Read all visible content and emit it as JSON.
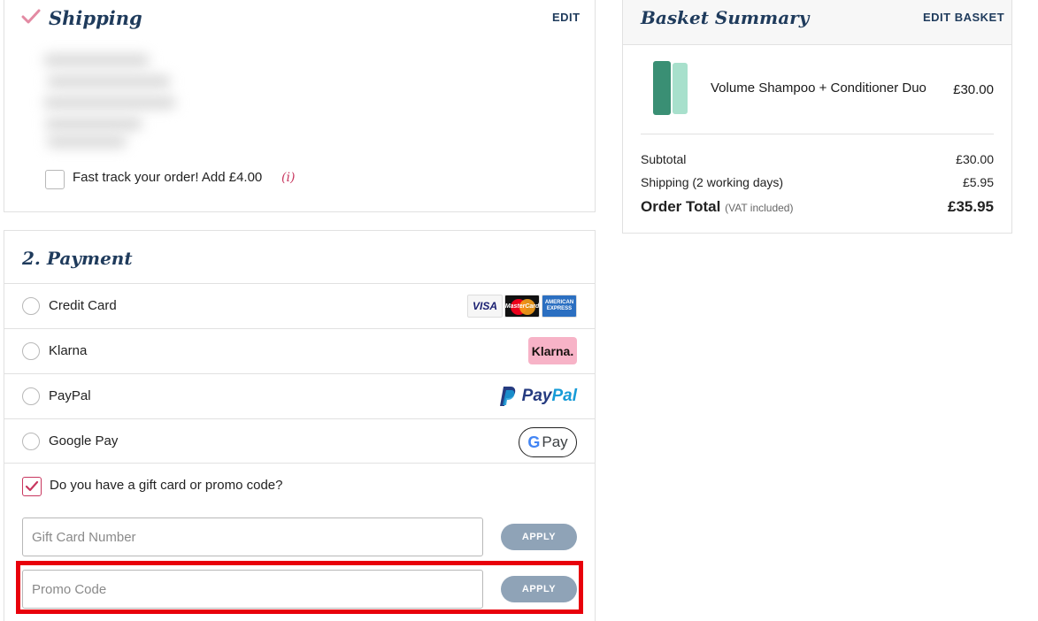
{
  "shipping": {
    "title": "Shipping",
    "edit_label": "EDIT",
    "fast_track_label": "Fast track your order! Add £4.00",
    "info_glyph": "(i)"
  },
  "payment": {
    "title": "2. Payment",
    "methods": [
      {
        "label": "Credit Card",
        "logo": "visa-mastercard-amex-logos"
      },
      {
        "label": "Klarna",
        "logo_text": "Klarna."
      },
      {
        "label": "PayPal",
        "logo_text_1": "Pay",
        "logo_text_2": "Pal"
      },
      {
        "label": "Google Pay",
        "logo_text_g": "G",
        "logo_text_pay": "Pay"
      }
    ],
    "card_logos": {
      "visa": "VISA",
      "mastercard": "MasterCard",
      "amex": "AMERICAN EXPRESS"
    },
    "gift_question": "Do you have a gift card or promo code?",
    "gift_card_placeholder": "Gift Card Number",
    "promo_placeholder": "Promo Code",
    "apply_label": "APPLY"
  },
  "basket": {
    "title": "Basket Summary",
    "edit_label": "EDIT BASKET",
    "product_name": "Volume Shampoo + Conditioner Duo",
    "product_price": "£30.00",
    "subtotal_label": "Subtotal",
    "subtotal_value": "£30.00",
    "shipping_label": "Shipping (2 working days)",
    "shipping_value": "£5.95",
    "total_label": "Order Total",
    "total_vat": "(VAT included)",
    "total_value": "£35.95"
  },
  "colors": {
    "accent_pink": "#c8375f",
    "title_navy": "#1f3b5c",
    "apply_button": "#8fa3b7",
    "highlight_red": "#e8000b"
  }
}
